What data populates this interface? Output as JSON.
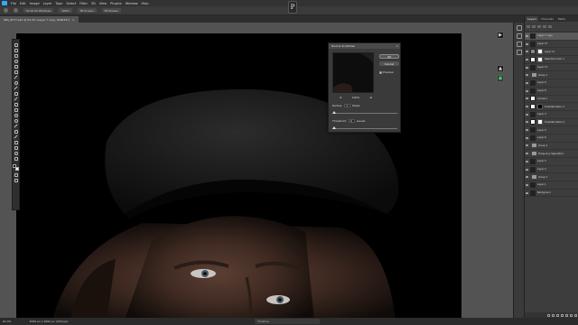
{
  "menubar": {
    "items": [
      "File",
      "Edit",
      "Image",
      "Layer",
      "Type",
      "Select",
      "Filter",
      "3D",
      "View",
      "Plugins",
      "Window",
      "Help"
    ]
  },
  "optionsbar": {
    "buttons": [
      "Scroll All Windows",
      "100%",
      "Fit Screen",
      "Fill Screen"
    ]
  },
  "share_label": "P",
  "document": {
    "tab_title": "IMG_8577.psd @ 62.4% (Layer 7 copy, RGB/16*)"
  },
  "dialog": {
    "title": "Dust & Scratches",
    "ok": "OK",
    "cancel": "Cancel",
    "preview_label": "Preview",
    "zoom_value": "100%",
    "radius_label": "Radius:",
    "radius_value": "1",
    "radius_unit": "Pixels",
    "threshold_label": "Threshold:",
    "threshold_value": "0",
    "threshold_unit": "Levels"
  },
  "layers_panel": {
    "tabs": [
      "Layers",
      "Channels",
      "Paths"
    ],
    "layers": [
      {
        "name": "Layer 7 copy",
        "thumb": "dark",
        "mask": "",
        "selected": true
      },
      {
        "name": "Layer 13",
        "thumb": "dark",
        "mask": "",
        "selected": false
      },
      {
        "name": "Layer 12",
        "thumb": "gray",
        "mask": "white",
        "selected": false
      },
      {
        "name": "Selective Color 1",
        "thumb": "white",
        "mask": "white",
        "selected": false
      },
      {
        "name": "Layer 10",
        "thumb": "dark",
        "mask": "",
        "selected": false
      },
      {
        "name": "Group 1",
        "thumb": "folder",
        "mask": "",
        "selected": false
      },
      {
        "name": "Layer 9",
        "thumb": "dark",
        "mask": "",
        "selected": false
      },
      {
        "name": "Layer 8",
        "thumb": "dark",
        "mask": "",
        "selected": false
      },
      {
        "name": "Curves 2",
        "thumb": "white",
        "mask": "",
        "selected": false
      },
      {
        "name": "Hue/Saturation 1",
        "thumb": "white",
        "mask": "dark",
        "selected": false
      },
      {
        "name": "Layer 4",
        "thumb": "dark",
        "mask": "",
        "selected": false
      },
      {
        "name": "Hue/Saturation 2",
        "thumb": "white",
        "mask": "white",
        "selected": false
      },
      {
        "name": "Layer 5",
        "thumb": "dark",
        "mask": "",
        "selected": false
      },
      {
        "name": "Layer 6",
        "thumb": "dark",
        "mask": "",
        "selected": false
      },
      {
        "name": "Group 2",
        "thumb": "folder",
        "mask": "",
        "selected": false
      },
      {
        "name": "Frequency Separation",
        "thumb": "folder",
        "mask": "",
        "selected": false
      },
      {
        "name": "Layer 3",
        "thumb": "dark",
        "mask": "",
        "selected": false
      },
      {
        "name": "Layer 2",
        "thumb": "dark",
        "mask": "",
        "selected": false
      },
      {
        "name": "Group 3",
        "thumb": "folder",
        "mask": "",
        "selected": false
      },
      {
        "name": "Layer 1",
        "thumb": "dark",
        "mask": "",
        "selected": false
      },
      {
        "name": "Background",
        "thumb": "dark",
        "mask": "",
        "selected": false
      }
    ]
  },
  "statusbar": {
    "zoom": "62.4%",
    "doc_size": "3000 px x 4000 px (300 ppi)",
    "timeline": "Timeline"
  },
  "icons": {
    "play": "play-icon",
    "extension": "extension-icon"
  }
}
